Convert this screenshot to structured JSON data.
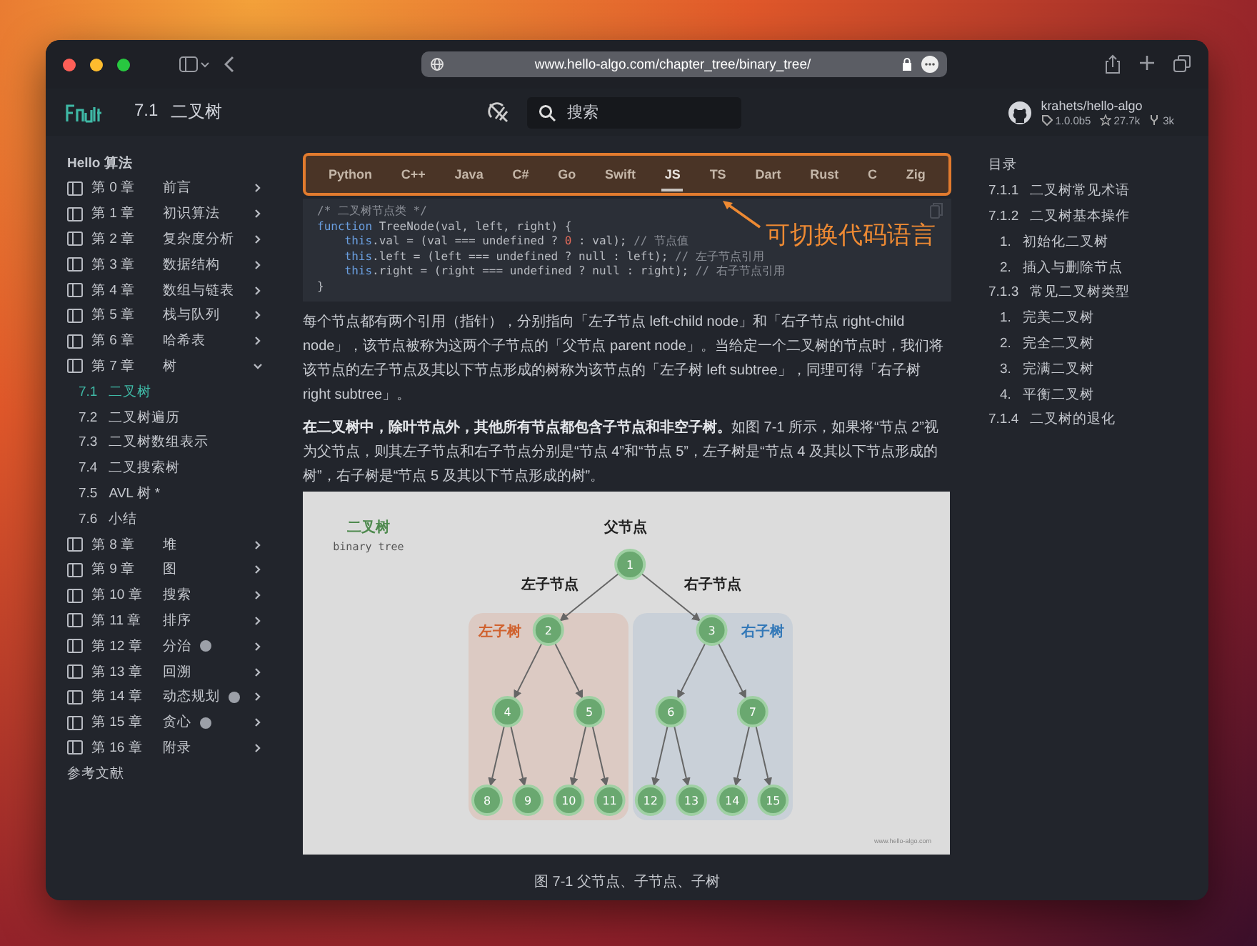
{
  "browser": {
    "url": "www.hello-algo.com/chapter_tree/binary_tree/"
  },
  "header": {
    "section_number": "7.1",
    "section_title": "二叉树",
    "search": {
      "placeholder": "搜索"
    },
    "repo": {
      "name": "krahets/hello-algo",
      "version": "1.0.0b5",
      "stars": "27.7k",
      "forks": "3k"
    }
  },
  "sidebar": {
    "title": "Hello 算法",
    "items": [
      {
        "chapter": "第 0 章",
        "label": "前言",
        "expanded": false,
        "badge": false
      },
      {
        "chapter": "第 1 章",
        "label": "初识算法",
        "expanded": false,
        "badge": false
      },
      {
        "chapter": "第 2 章",
        "label": "复杂度分析",
        "expanded": false,
        "badge": false
      },
      {
        "chapter": "第 3 章",
        "label": "数据结构",
        "expanded": false,
        "badge": false
      },
      {
        "chapter": "第 4 章",
        "label": "数组与链表",
        "expanded": false,
        "badge": false
      },
      {
        "chapter": "第 5 章",
        "label": "栈与队列",
        "expanded": false,
        "badge": false
      },
      {
        "chapter": "第 6 章",
        "label": "哈希表",
        "expanded": false,
        "badge": false
      },
      {
        "chapter": "第 7 章",
        "label": "树",
        "expanded": true,
        "badge": false,
        "children": [
          {
            "number": "7.1",
            "label": "二叉树",
            "selected": true
          },
          {
            "number": "7.2",
            "label": "二叉树遍历",
            "selected": false
          },
          {
            "number": "7.3",
            "label": "二叉树数组表示",
            "selected": false
          },
          {
            "number": "7.4",
            "label": "二叉搜索树",
            "selected": false
          },
          {
            "number": "7.5",
            "label": "AVL 树 *",
            "selected": false
          },
          {
            "number": "7.6",
            "label": "小结",
            "selected": false
          }
        ]
      },
      {
        "chapter": "第 8 章",
        "label": "堆",
        "expanded": false,
        "badge": false
      },
      {
        "chapter": "第 9 章",
        "label": "图",
        "expanded": false,
        "badge": false
      },
      {
        "chapter": "第 10 章",
        "label": "搜索",
        "expanded": false,
        "badge": false
      },
      {
        "chapter": "第 11 章",
        "label": "排序",
        "expanded": false,
        "badge": false
      },
      {
        "chapter": "第 12 章",
        "label": "分治",
        "expanded": false,
        "badge": true
      },
      {
        "chapter": "第 13 章",
        "label": "回溯",
        "expanded": false,
        "badge": false
      },
      {
        "chapter": "第 14 章",
        "label": "动态规划",
        "expanded": false,
        "badge": true
      },
      {
        "chapter": "第 15 章",
        "label": "贪心",
        "expanded": false,
        "badge": true
      },
      {
        "chapter": "第 16 章",
        "label": "附录",
        "expanded": false,
        "badge": false
      }
    ],
    "footer": "参考文献"
  },
  "code_tabs": [
    {
      "label": "Python",
      "selected": false
    },
    {
      "label": "C++",
      "selected": false
    },
    {
      "label": "Java",
      "selected": false
    },
    {
      "label": "C#",
      "selected": false
    },
    {
      "label": "Go",
      "selected": false
    },
    {
      "label": "Swift",
      "selected": false
    },
    {
      "label": "JS",
      "selected": true
    },
    {
      "label": "TS",
      "selected": false
    },
    {
      "label": "Dart",
      "selected": false
    },
    {
      "label": "Rust",
      "selected": false
    },
    {
      "label": "C",
      "selected": false
    },
    {
      "label": "Zig",
      "selected": false
    }
  ],
  "annotation": "可切换代码语言",
  "code": {
    "lines": [
      [
        {
          "kind": "comment",
          "text": "/* 二叉树节点类 */"
        }
      ],
      [
        {
          "kind": "keyword",
          "text": "function"
        },
        {
          "kind": "plain",
          "text": " TreeNode(val, left, right) {"
        }
      ],
      [
        {
          "kind": "keyword",
          "text": "    this"
        },
        {
          "kind": "plain",
          "text": ".val = (val === undefined ? "
        },
        {
          "kind": "number",
          "text": "0"
        },
        {
          "kind": "plain",
          "text": " : val); "
        },
        {
          "kind": "comment",
          "text": "// 节点值"
        }
      ],
      [
        {
          "kind": "keyword",
          "text": "    this"
        },
        {
          "kind": "plain",
          "text": ".left = (left === undefined ? null : left); "
        },
        {
          "kind": "comment",
          "text": "// 左子节点引用"
        }
      ],
      [
        {
          "kind": "keyword",
          "text": "    this"
        },
        {
          "kind": "plain",
          "text": ".right = (right === undefined ? null : right); "
        },
        {
          "kind": "comment",
          "text": "// 右子节点引用"
        }
      ],
      [
        {
          "kind": "plain",
          "text": "}"
        }
      ]
    ]
  },
  "paragraphs": [
    "每个节点都有两个引用（指针），分别指向「左子节点 left-child node」和「右子节点 right-child node」，该节点被称为这两个子节点的「父节点 parent node」。当给定一个二叉树的节点时，我们将该节点的左子节点及其以下节点形成的树称为该节点的「左子树 left subtree」，同理可得「右子树 right subtree」。",
    "**在二叉树中，除叶节点外，其他所有节点都包含子节点和非空子树。**如图 7-1 所示，如果将“节点 2”视为父节点，则其左子节点和右子节点分别是“节点 4”和“节点 5”，左子树是“节点 4 及其以下节点形成的树”，右子树是“节点 5 及其以下节点形成的树”。"
  ],
  "figure": {
    "title": "二叉树",
    "subtitle": "binary tree",
    "parent_label": "父节点",
    "left_child_label": "左子节点",
    "right_child_label": "右子节点",
    "left_subtree_label": "左子树",
    "right_subtree_label": "右子树",
    "credit": "www.hello-algo.com",
    "tree": {
      "label": "1",
      "children": [
        {
          "label": "2",
          "children": [
            {
              "label": "4",
              "children": [
                {
                  "label": "8"
                },
                {
                  "label": "9"
                }
              ]
            },
            {
              "label": "5",
              "children": [
                {
                  "label": "10"
                },
                {
                  "label": "11"
                }
              ]
            }
          ]
        },
        {
          "label": "3",
          "children": [
            {
              "label": "6",
              "children": [
                {
                  "label": "12"
                },
                {
                  "label": "13"
                }
              ]
            },
            {
              "label": "7",
              "children": [
                {
                  "label": "14"
                },
                {
                  "label": "15"
                }
              ]
            }
          ]
        }
      ]
    }
  },
  "caption": "图 7-1   父节点、子节点、子树",
  "toc": {
    "title": "目录",
    "items": [
      {
        "number": "7.1.1",
        "label": "二叉树常见术语"
      },
      {
        "number": "7.1.2",
        "label": "二叉树基本操作",
        "children": [
          {
            "number": "1.",
            "label": "初始化二叉树"
          },
          {
            "number": "2.",
            "label": "插入与删除节点"
          }
        ]
      },
      {
        "number": "7.1.3",
        "label": "常见二叉树类型",
        "children": [
          {
            "number": "1.",
            "label": "完美二叉树"
          },
          {
            "number": "2.",
            "label": "完全二叉树"
          },
          {
            "number": "3.",
            "label": "完满二叉树"
          },
          {
            "number": "4.",
            "label": "平衡二叉树"
          }
        ]
      },
      {
        "number": "7.1.4",
        "label": "二叉树的退化"
      }
    ]
  }
}
